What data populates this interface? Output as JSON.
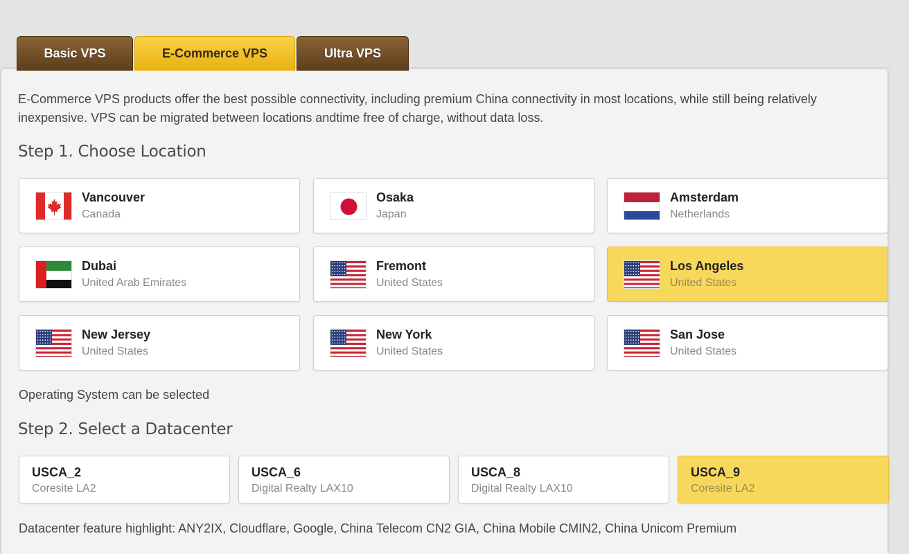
{
  "tabs": [
    {
      "label": "Basic VPS",
      "active": false
    },
    {
      "label": "E-Commerce VPS",
      "active": true
    },
    {
      "label": "Ultra VPS",
      "active": false
    }
  ],
  "intro": "E-Commerce VPS products offer the best possible connectivity, including premium China connectivity in most locations, while still being relatively inexpensive. VPS can be migrated between locations andtime free of charge, without data loss.",
  "step1": {
    "title": "Step 1. Choose Location"
  },
  "locations": [
    {
      "name": "Vancouver",
      "country": "Canada",
      "flag": "canada-flag-icon",
      "selected": false
    },
    {
      "name": "Osaka",
      "country": "Japan",
      "flag": "japan-flag-icon",
      "selected": false
    },
    {
      "name": "Amsterdam",
      "country": "Netherlands",
      "flag": "netherlands-flag-icon",
      "selected": false
    },
    {
      "name": "Dubai",
      "country": "United Arab Emirates",
      "flag": "uae-flag-icon",
      "selected": false
    },
    {
      "name": "Fremont",
      "country": "United States",
      "flag": "usa-flag-icon",
      "selected": false
    },
    {
      "name": "Los Angeles",
      "country": "United States",
      "flag": "usa-flag-icon",
      "selected": true
    },
    {
      "name": "New Jersey",
      "country": "United States",
      "flag": "usa-flag-icon",
      "selected": false
    },
    {
      "name": "New York",
      "country": "United States",
      "flag": "usa-flag-icon",
      "selected": false
    },
    {
      "name": "San Jose",
      "country": "United States",
      "flag": "usa-flag-icon",
      "selected": false
    }
  ],
  "os_note": "Operating System can be selected",
  "step2": {
    "title": "Step 2. Select a Datacenter"
  },
  "datacenters": [
    {
      "code": "USCA_2",
      "provider": "Coresite LA2",
      "selected": false
    },
    {
      "code": "USCA_6",
      "provider": "Digital Realty LAX10",
      "selected": false
    },
    {
      "code": "USCA_8",
      "provider": "Digital Realty LAX10",
      "selected": false
    },
    {
      "code": "USCA_9",
      "provider": "Coresite LA2",
      "selected": true
    }
  ],
  "feature_note": "Datacenter feature highlight: ANY2IX, Cloudflare, Google, China Telecom CN2 GIA, China Mobile CMIN2, China Unicom Premium",
  "colors": {
    "accent": "#f8d85a",
    "tab_dark": "#6e4a25",
    "tab_active": "#f0c22a"
  }
}
